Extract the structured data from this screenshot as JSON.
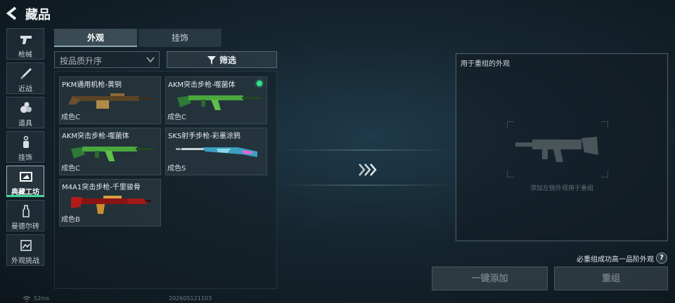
{
  "header": {
    "title": "藏品",
    "back_icon": "back-chevron-icon"
  },
  "sidebar": {
    "items": [
      {
        "label": "枪械",
        "icon": "pistol-icon",
        "active": false
      },
      {
        "label": "近战",
        "icon": "knife-icon",
        "active": false
      },
      {
        "label": "道具",
        "icon": "grenade-icon",
        "active": false
      },
      {
        "label": "挂饰",
        "icon": "charm-icon",
        "active": false
      },
      {
        "label": "典藏工坊",
        "icon": "workshop-icon",
        "active": true
      },
      {
        "label": "曼德尔砖",
        "icon": "brick-icon",
        "active": false
      },
      {
        "label": "外观挑战",
        "icon": "challenge-icon",
        "active": false
      }
    ],
    "active_color": "#3fd59a"
  },
  "tabs": [
    {
      "label": "外观",
      "active": true
    },
    {
      "label": "挂饰",
      "active": false
    }
  ],
  "sort": {
    "value": "按品质升序"
  },
  "filter": {
    "label": "筛选"
  },
  "cards": [
    {
      "name": "PKM通用机枪-黄铜",
      "grade": "成色C",
      "new": false,
      "colors": [
        "#4a3a22",
        "#b08a4a"
      ]
    },
    {
      "name": "AKM突击步枪-噬菌体",
      "grade": "成色C",
      "new": true,
      "colors": [
        "#1f5a2a",
        "#5fbf4a"
      ]
    },
    {
      "name": "AKM突击步枪-噬菌体",
      "grade": "成色C",
      "new": false,
      "colors": [
        "#1f5a2a",
        "#5fbf4a"
      ]
    },
    {
      "name": "SKS射手步枪-彩墨涂鸦",
      "grade": "成色S",
      "new": false,
      "colors": [
        "#2a6f8a",
        "#8fd6e8"
      ]
    },
    {
      "name": "M4A1突击步枪-千里骏骨",
      "grade": "成色B",
      "new": false,
      "colors": [
        "#7a1010",
        "#d6a040"
      ]
    }
  ],
  "right_panel": {
    "title": "用于重组的外观",
    "placeholder": "添加左侧外观用于重组",
    "hint": "必重组成功高一品阶外观",
    "help_label": "?"
  },
  "buttons": {
    "add_all": "一键添加",
    "rebuild": "重组"
  },
  "status": {
    "ping": "52ms",
    "build": "202605121103"
  }
}
